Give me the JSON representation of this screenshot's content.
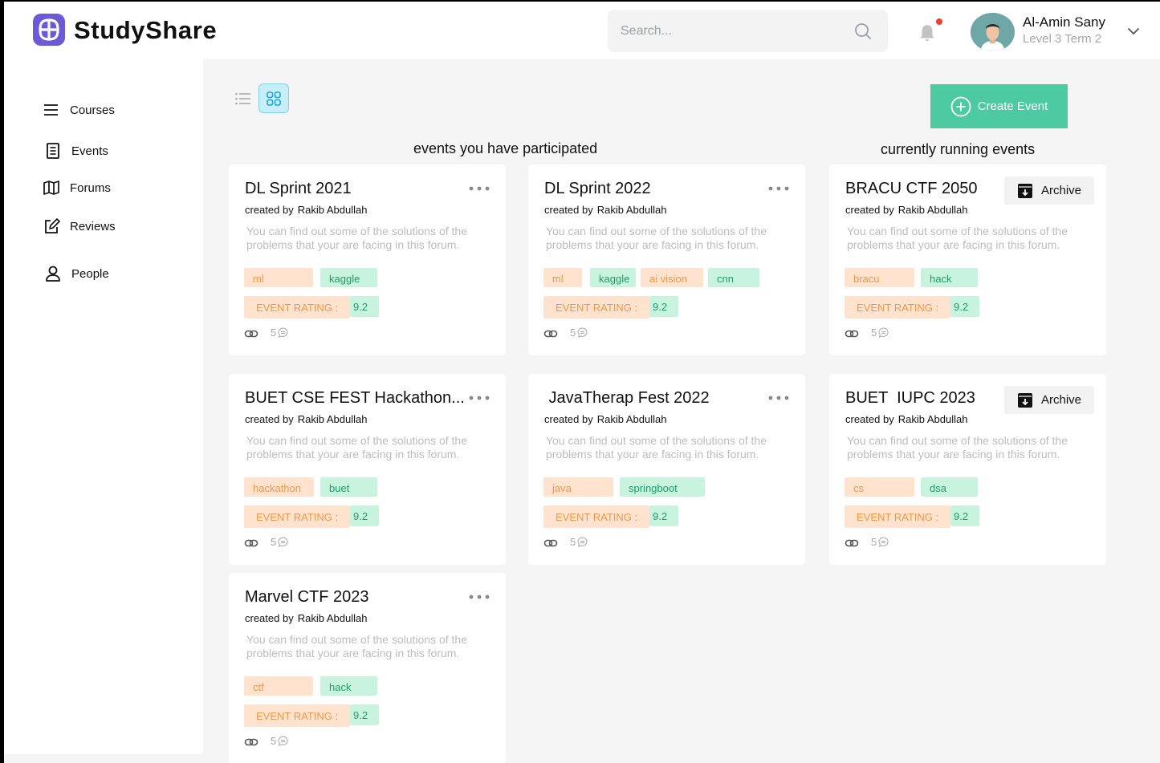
{
  "app": {
    "name": "StudyShare"
  },
  "search": {
    "placeholder": "Search..."
  },
  "user": {
    "name": "Al-Amin Sany",
    "level": "Level 3 Term 2"
  },
  "sidebar": {
    "items": [
      {
        "label": "Courses",
        "icon": "menu-icon"
      },
      {
        "label": "Events",
        "icon": "document-icon"
      },
      {
        "label": "Forums",
        "icon": "map-icon"
      },
      {
        "label": "Reviews",
        "icon": "edit-icon"
      },
      {
        "label": "People",
        "icon": "person-icon"
      }
    ]
  },
  "toolbar": {
    "create_label": "Create Event"
  },
  "sections": {
    "participated": "events  you have participated",
    "running": "currently running events"
  },
  "common": {
    "created_by": "created by",
    "rating_label": "EVENT RATING  :",
    "archive_label": "Archive"
  },
  "colors": {
    "accent": "#4dcaa1",
    "brand": "#6b5ad6",
    "tag_orange": "#ffe3cf",
    "tag_green": "#c8f3df",
    "notification": "#f03e2f"
  },
  "participated_events": [
    {
      "title": "DL Sprint 2021",
      "creator": "Rakib Abdullah",
      "description": "You can find out some of the solutions of the problems  that your are facing in this forum.",
      "tags": [
        "ml",
        "kaggle"
      ],
      "rating": "9.2",
      "comments": "5"
    },
    {
      "title": "DL Sprint 2022",
      "creator": "Rakib Abdullah",
      "description": "You can find out some of the solutions of the problems  that your are facing in this forum.",
      "tags": [
        "ml",
        "kaggle",
        "ai vision",
        "cnn"
      ],
      "rating": "9.2",
      "comments": "5"
    },
    {
      "title": "BUET CSE FEST Hackathon...",
      "creator": "Rakib Abdullah",
      "description": "You can find out some of the solutions of the problems  that your are facing in this forum.",
      "tags": [
        "hackathon",
        "buet"
      ],
      "rating": "9.2",
      "comments": "5"
    },
    {
      "title": " JavaTherap Fest 2022",
      "creator": "Rakib Abdullah",
      "description": "You can find out some of the solutions of the problems  that your are facing in this forum.",
      "tags": [
        "java",
        "springboot"
      ],
      "rating": "9.2",
      "comments": "5"
    },
    {
      "title": "Marvel CTF 2023",
      "creator": "Rakib Abdullah",
      "description": "You can find out some of the solutions of the problems  that your are facing in this forum.",
      "tags": [
        "ctf",
        "hack"
      ],
      "rating": "9.2",
      "comments": "5"
    }
  ],
  "running_events": [
    {
      "title": "BRACU CTF 2050",
      "creator": "Rakib Abdullah",
      "description": "You can find out some of the solutions of the problems  that your are facing in this forum.",
      "tags": [
        "bracu",
        "hack"
      ],
      "rating": "9.2",
      "comments": "5"
    },
    {
      "title": "BUET  IUPC 2023",
      "creator": "Rakib Abdullah",
      "description": "You can find out some of the solutions of the problems  that your are facing in this forum.",
      "tags": [
        "cs",
        "dsa"
      ],
      "rating": "9.2",
      "comments": "5"
    }
  ]
}
